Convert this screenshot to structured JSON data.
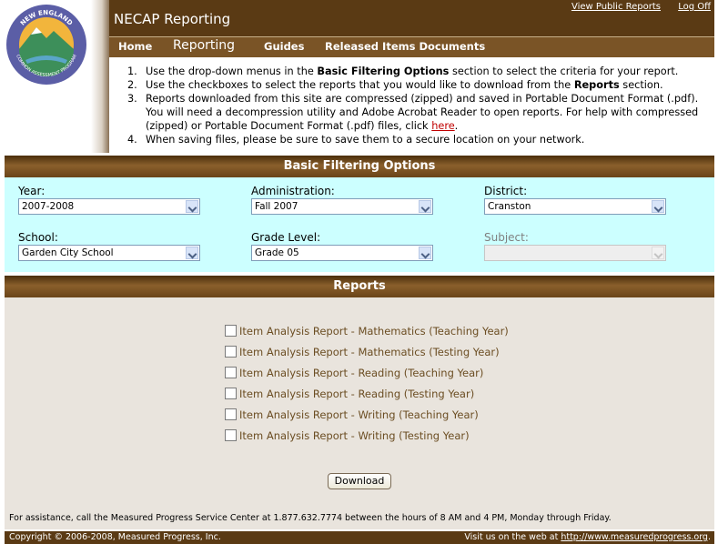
{
  "header": {
    "logo_text": "NEW ENGLAND COMMON ASSESSMENT PROGRAM",
    "app_title": "NECAP Reporting",
    "links": [
      "View Public Reports",
      "Log Off"
    ]
  },
  "nav": {
    "items": [
      "Home",
      "Reporting",
      "Guides",
      "Released Items Documents"
    ]
  },
  "instructions": {
    "items": [
      {
        "num": "1.",
        "pre": "Use the drop-down menus in the ",
        "bold": "Basic Filtering Options",
        "post": " section to select the criteria for your report."
      },
      {
        "num": "2.",
        "pre": "Use the checkboxes to select the reports that you would like to download from the ",
        "bold": "Reports",
        "post": " section."
      },
      {
        "num": "3.",
        "pre": "Reports downloaded from this site are compressed (zipped) and saved in Portable Document Format (.pdf). You will need a decompression utility and Adobe Acrobat Reader to open reports. For help with compressed (zipped) or Portable Document Format (.pdf) files, click ",
        "link": "here",
        "post": "."
      },
      {
        "num": "4.",
        "pre": "When saving files, please be sure to save them to a secure location on your network."
      }
    ]
  },
  "filters": {
    "title": "Basic Filtering Options",
    "year": {
      "label": "Year:",
      "value": "2007-2008"
    },
    "administration": {
      "label": "Administration:",
      "value": "Fall 2007"
    },
    "district": {
      "label": "District:",
      "value": "Cranston"
    },
    "school": {
      "label": "School:",
      "value": "Garden City School"
    },
    "grade": {
      "label": "Grade Level:",
      "value": "Grade 05"
    },
    "subject": {
      "label": "Subject:",
      "value": ""
    }
  },
  "reports": {
    "title": "Reports",
    "items": [
      "Item Analysis Report - Mathematics (Teaching Year)",
      "Item Analysis Report - Mathematics (Testing Year)",
      "Item Analysis Report - Reading (Teaching Year)",
      "Item Analysis Report - Reading (Testing Year)",
      "Item Analysis Report - Writing (Teaching Year)",
      "Item Analysis Report - Writing (Testing Year)"
    ],
    "download_label": "Download",
    "assistance": "For assistance, call the Measured Progress Service Center at 1.877.632.7774 between the hours of 8 AM and 4 PM, Monday through Friday."
  },
  "footer": {
    "copyright": "Copyright © 2006-2008, Measured Progress, Inc.",
    "visit_prefix": "Visit us on the web at ",
    "visit_url": "http://www.measuredprogress.org",
    "visit_suffix": "."
  },
  "colors": {
    "header_brown": "#5a3a14",
    "nav_brown": "#7a5426",
    "filter_bg": "#ccffff",
    "reports_bg": "#e9e4dd",
    "report_text": "#6b4d22",
    "link_red": "#c00000"
  }
}
